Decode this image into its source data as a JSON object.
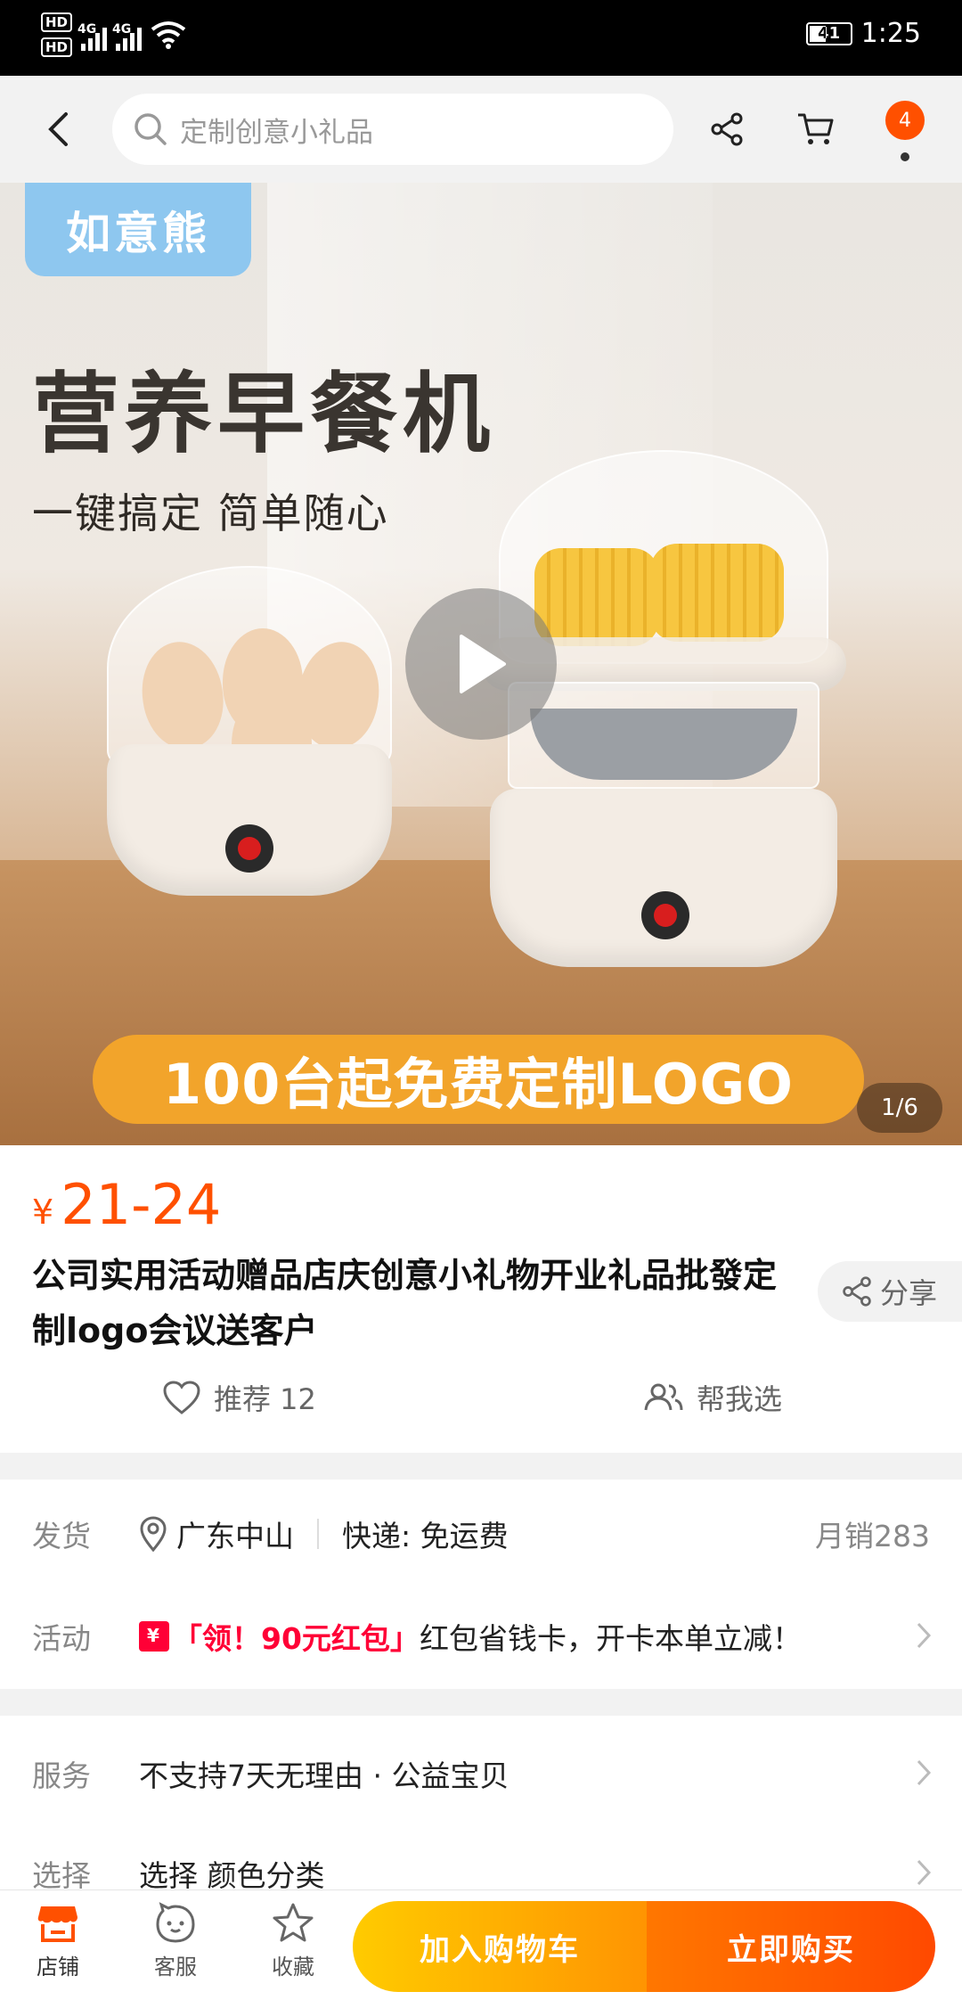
{
  "status_bar": {
    "hd1": "HD",
    "hd2": "HD",
    "net1": "4G",
    "net2": "4G",
    "battery": "41",
    "time": "1:25"
  },
  "nav": {
    "search_placeholder": "定制创意小礼品",
    "cart_badge": "4"
  },
  "hero": {
    "brand": "如意熊",
    "title": "营养早餐机",
    "subtitle": "一键搞定 简单随心",
    "banner": "100台起免费定制LOGO",
    "counter": "1/6"
  },
  "product": {
    "currency": "¥",
    "price": "21-24",
    "title": "公司实用活动赠品店庆创意小礼物开业礼品批發定制logo会议送客户",
    "share_label": "分享",
    "recommend_label": "推荐 12",
    "help_choose_label": "帮我选"
  },
  "shipping": {
    "label": "发货",
    "location": "广东中山",
    "delivery": "快递: 免运费",
    "monthly_sales": "月销283"
  },
  "activity": {
    "label": "活动",
    "promo": "「领！90元红包」",
    "text": "红包省钱卡，开卡本单立减！"
  },
  "service": {
    "label": "服务",
    "text": "不支持7天无理由 · 公益宝贝"
  },
  "select": {
    "label": "选择",
    "text": "选择 颜色分类"
  },
  "bottom": {
    "shop": "店铺",
    "service": "客服",
    "favorite": "收藏",
    "add_to_cart": "加入购物车",
    "buy_now": "立即购买"
  },
  "colors": {
    "accent": "#ff5000",
    "promo_red": "#ff0036",
    "cart_yellow": "#ffcb00",
    "buy_orange": "#ff4900"
  }
}
